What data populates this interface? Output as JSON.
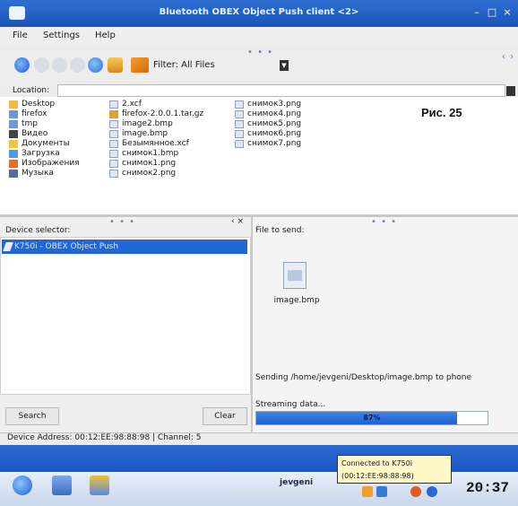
{
  "window": {
    "title": "Bluetooth OBEX Object Push client <2>",
    "controls": [
      "–",
      "□",
      "×"
    ]
  },
  "menu": {
    "file": "File",
    "settings": "Settings",
    "help": "Help"
  },
  "toolbar": {
    "grip": "• • •",
    "filter_label": "Filter: All Files",
    "end_grip": "‹ ›"
  },
  "location": {
    "label": "Location:",
    "value": ""
  },
  "files": {
    "col1": [
      "Desktop",
      "firefox",
      "tmp",
      "Видео",
      "Документы",
      "Загрузка",
      "Изображения",
      "Музыка"
    ],
    "col2": [
      "2.xcf",
      "firefox-2.0.0.1.tar.gz",
      "image2.bmp",
      "image.bmp",
      "Безымянное.xcf",
      "снимок1.bmp",
      "снимок1.png",
      "снимок2.png"
    ],
    "col3": [
      "снимок3.png",
      "снимок4.png",
      "снимок5.png",
      "снимок6.png",
      "снимок7.png"
    ]
  },
  "figure_label": "Рис. 25",
  "left_pane": {
    "header": "Device selector:",
    "device": "K750i - OBEX Object Push",
    "search_button": "Search",
    "clear_button": "Clear",
    "grip": "• • •",
    "close": "‹ ×"
  },
  "right_pane": {
    "header": "File to send:",
    "file_name": "image.bmp",
    "sending": "Sending /home/jevgeni/Desktop/image.bmp to phone",
    "streaming": "Streaming data...",
    "progress_text": "87%",
    "progress": 0.87,
    "grip": "• • •"
  },
  "status": {
    "text": "Device Address: 00:12:EE:98:88:98 | Channel: 5"
  },
  "taskbar": {
    "user": "jevgeni",
    "tooltip_line1": "Connected to K750i",
    "tooltip_line2": "(00:12:EE:98:88:98)",
    "clock": "20:37"
  },
  "colors": {
    "titlebar": "#1f5cc2",
    "selection": "#2166d6",
    "taskbar": "#2d6bd2",
    "tooltip": "#fff7c6"
  }
}
